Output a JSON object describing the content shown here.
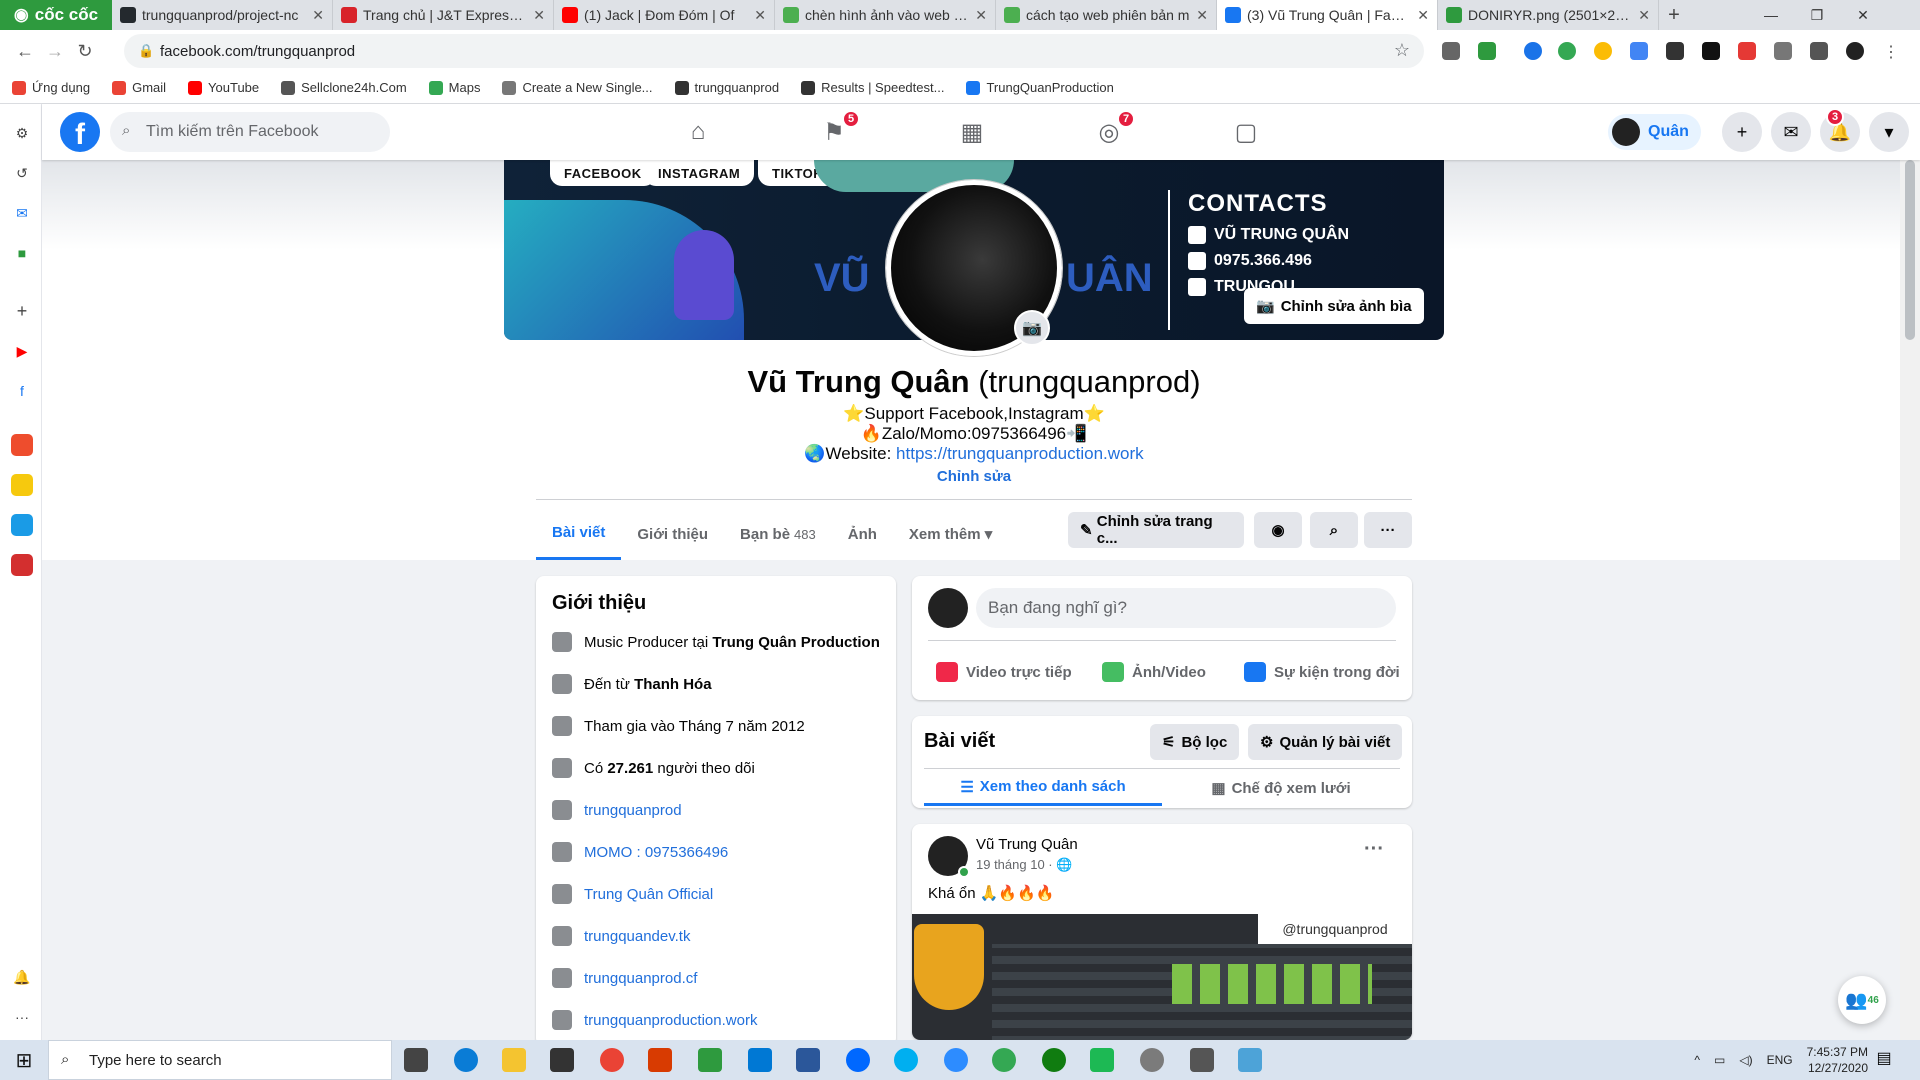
{
  "browser": {
    "brand": "cốc cốc",
    "tabs": [
      {
        "title": "trungquanprod/project-nc",
        "color": "#24292e"
      },
      {
        "title": "Trang chủ | J&T Express Việ",
        "color": "#d8232a"
      },
      {
        "title": "(1) Jack | Đom Đóm | Of",
        "color": "#ff0000"
      },
      {
        "title": "chèn hình ảnh vào web - Tì",
        "color": "#4caf50"
      },
      {
        "title": "cách tạo web phiên bản m",
        "color": "#4caf50"
      },
      {
        "title": "(3) Vũ Trung Quân | Faceb",
        "color": "#1877f2"
      },
      {
        "title": "DONIRYR.png (2501×2501",
        "color": "#2e9a3e"
      }
    ],
    "url": "facebook.com/trungquanprod",
    "bookmarks": [
      {
        "label": "Ứng dụng",
        "color": "#ea4335"
      },
      {
        "label": "Gmail",
        "color": "#ea4335"
      },
      {
        "label": "YouTube",
        "color": "#ff0000"
      },
      {
        "label": "Sellclone24h.Com",
        "color": "#555555"
      },
      {
        "label": "Maps",
        "color": "#34a853"
      },
      {
        "label": "Create a New Single...",
        "color": "#777777"
      },
      {
        "label": "trungquanprod",
        "color": "#333333"
      },
      {
        "label": "Results | Speedtest...",
        "color": "#333333"
      },
      {
        "label": "TrungQuanProduction",
        "color": "#1877f2"
      }
    ]
  },
  "fb": {
    "search_placeholder": "Tìm kiếm trên Facebook",
    "badges": {
      "flag": "5",
      "groups": "7",
      "notifications": "3"
    },
    "user_name": "Quân"
  },
  "profile": {
    "cover_pills": [
      "FACEBOOK",
      "INSTAGRAM",
      "TIKTOK"
    ],
    "cover_contacts_title": "CONTACTS",
    "cover_contact_name": "VŨ TRUNG QUÂN",
    "cover_contact_phone": "0975.366.496",
    "cover_contact_mail": "TRUNGQU",
    "cover_left_text": "VŨ",
    "cover_right_text": "UÂN",
    "edit_cover": "Chỉnh sửa ảnh bìa",
    "name": "Vũ Trung Quân",
    "alt_name": "(trungquanprod)",
    "bio_line1": "⭐Support Facebook,Instagram⭐",
    "bio_line2": "🔥Zalo/Momo:0975366496📲",
    "bio_line3_prefix": "🌏Website: ",
    "bio_line3_link": "https://trungquanproduction.work",
    "bio_edit": "Chỉnh sửa",
    "tabs": [
      {
        "label": "Bài viết"
      },
      {
        "label": "Giới thiệu"
      },
      {
        "label": "Bạn bè",
        "count": "483"
      },
      {
        "label": "Ảnh"
      },
      {
        "label": "Xem thêm ▾"
      }
    ],
    "edit_profile": "Chỉnh sửa trang c..."
  },
  "intro": {
    "title": "Giới thiệu",
    "rows": [
      {
        "pre": "Music Producer tại ",
        "bold": "Trung Quân Production",
        "post": "",
        "link": false
      },
      {
        "pre": "Đến từ ",
        "bold": "Thanh Hóa",
        "post": "",
        "link": false
      },
      {
        "pre": "Tham gia vào Tháng 7 năm 2012",
        "bold": "",
        "post": "",
        "link": false
      },
      {
        "pre": "Có ",
        "bold": "27.261",
        "post": " người theo dõi",
        "link": false
      },
      {
        "pre": "trungquanprod",
        "bold": "",
        "post": "",
        "link": true
      },
      {
        "pre": "MOMO : 0975366496",
        "bold": "",
        "post": "",
        "link": true
      },
      {
        "pre": "Trung Quân Official",
        "bold": "",
        "post": "",
        "link": true
      },
      {
        "pre": "trungquandev.tk",
        "bold": "",
        "post": "",
        "link": true
      },
      {
        "pre": "trungquanprod.cf",
        "bold": "",
        "post": "",
        "link": true
      },
      {
        "pre": "trungquanproduction.work",
        "bold": "",
        "post": "",
        "link": true
      }
    ]
  },
  "composer": {
    "placeholder": "Bạn đang nghĩ gì?",
    "actions": [
      {
        "label": "Video trực tiếp",
        "color": "#f02849"
      },
      {
        "label": "Ảnh/Video",
        "color": "#45bd62"
      },
      {
        "label": "Sự kiện trong đời",
        "color": "#1877f2"
      }
    ]
  },
  "posts": {
    "title": "Bài viết",
    "filter": "Bộ lọc",
    "manage": "Quản lý bài viết",
    "list_view": "Xem theo danh sách",
    "grid_view": "Chế độ xem lưới"
  },
  "post": {
    "author": "Vũ Trung Quân",
    "date": "19 tháng 10 · 🌐",
    "text": "Khá ổn 🙏🔥🔥🔥",
    "image_tag": "@trungquanprod"
  },
  "chat": {
    "count": "46"
  },
  "taskbar": {
    "search": "Type here to search",
    "lang": "ENG",
    "time": "7:45:37 PM",
    "date": "12/27/2020"
  }
}
